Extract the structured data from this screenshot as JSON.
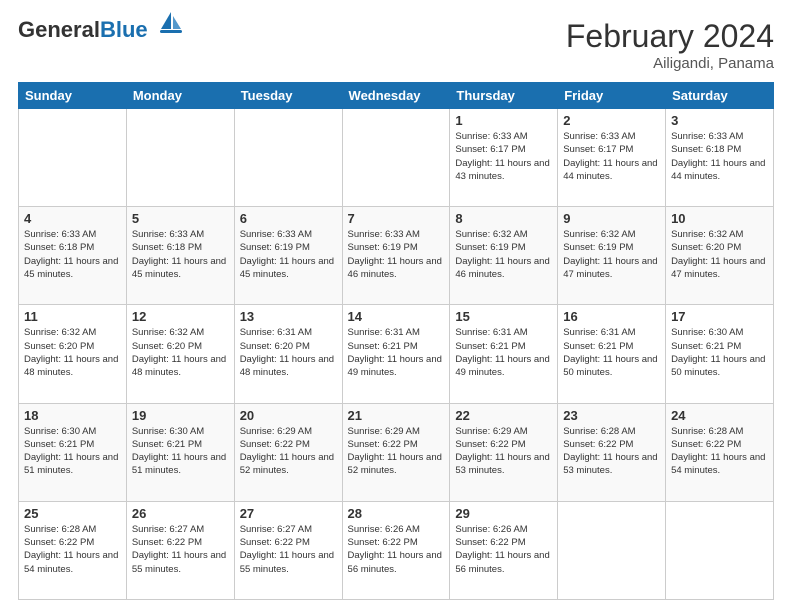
{
  "header": {
    "logo_general": "General",
    "logo_blue": "Blue",
    "month_title": "February 2024",
    "location": "Ailigandi, Panama"
  },
  "days_of_week": [
    "Sunday",
    "Monday",
    "Tuesday",
    "Wednesday",
    "Thursday",
    "Friday",
    "Saturday"
  ],
  "weeks": [
    [
      {
        "day": "",
        "info": ""
      },
      {
        "day": "",
        "info": ""
      },
      {
        "day": "",
        "info": ""
      },
      {
        "day": "",
        "info": ""
      },
      {
        "day": "1",
        "info": "Sunrise: 6:33 AM\nSunset: 6:17 PM\nDaylight: 11 hours\nand 43 minutes."
      },
      {
        "day": "2",
        "info": "Sunrise: 6:33 AM\nSunset: 6:17 PM\nDaylight: 11 hours\nand 44 minutes."
      },
      {
        "day": "3",
        "info": "Sunrise: 6:33 AM\nSunset: 6:18 PM\nDaylight: 11 hours\nand 44 minutes."
      }
    ],
    [
      {
        "day": "4",
        "info": "Sunrise: 6:33 AM\nSunset: 6:18 PM\nDaylight: 11 hours\nand 45 minutes."
      },
      {
        "day": "5",
        "info": "Sunrise: 6:33 AM\nSunset: 6:18 PM\nDaylight: 11 hours\nand 45 minutes."
      },
      {
        "day": "6",
        "info": "Sunrise: 6:33 AM\nSunset: 6:19 PM\nDaylight: 11 hours\nand 45 minutes."
      },
      {
        "day": "7",
        "info": "Sunrise: 6:33 AM\nSunset: 6:19 PM\nDaylight: 11 hours\nand 46 minutes."
      },
      {
        "day": "8",
        "info": "Sunrise: 6:32 AM\nSunset: 6:19 PM\nDaylight: 11 hours\nand 46 minutes."
      },
      {
        "day": "9",
        "info": "Sunrise: 6:32 AM\nSunset: 6:19 PM\nDaylight: 11 hours\nand 47 minutes."
      },
      {
        "day": "10",
        "info": "Sunrise: 6:32 AM\nSunset: 6:20 PM\nDaylight: 11 hours\nand 47 minutes."
      }
    ],
    [
      {
        "day": "11",
        "info": "Sunrise: 6:32 AM\nSunset: 6:20 PM\nDaylight: 11 hours\nand 48 minutes."
      },
      {
        "day": "12",
        "info": "Sunrise: 6:32 AM\nSunset: 6:20 PM\nDaylight: 11 hours\nand 48 minutes."
      },
      {
        "day": "13",
        "info": "Sunrise: 6:31 AM\nSunset: 6:20 PM\nDaylight: 11 hours\nand 48 minutes."
      },
      {
        "day": "14",
        "info": "Sunrise: 6:31 AM\nSunset: 6:21 PM\nDaylight: 11 hours\nand 49 minutes."
      },
      {
        "day": "15",
        "info": "Sunrise: 6:31 AM\nSunset: 6:21 PM\nDaylight: 11 hours\nand 49 minutes."
      },
      {
        "day": "16",
        "info": "Sunrise: 6:31 AM\nSunset: 6:21 PM\nDaylight: 11 hours\nand 50 minutes."
      },
      {
        "day": "17",
        "info": "Sunrise: 6:30 AM\nSunset: 6:21 PM\nDaylight: 11 hours\nand 50 minutes."
      }
    ],
    [
      {
        "day": "18",
        "info": "Sunrise: 6:30 AM\nSunset: 6:21 PM\nDaylight: 11 hours\nand 51 minutes."
      },
      {
        "day": "19",
        "info": "Sunrise: 6:30 AM\nSunset: 6:21 PM\nDaylight: 11 hours\nand 51 minutes."
      },
      {
        "day": "20",
        "info": "Sunrise: 6:29 AM\nSunset: 6:22 PM\nDaylight: 11 hours\nand 52 minutes."
      },
      {
        "day": "21",
        "info": "Sunrise: 6:29 AM\nSunset: 6:22 PM\nDaylight: 11 hours\nand 52 minutes."
      },
      {
        "day": "22",
        "info": "Sunrise: 6:29 AM\nSunset: 6:22 PM\nDaylight: 11 hours\nand 53 minutes."
      },
      {
        "day": "23",
        "info": "Sunrise: 6:28 AM\nSunset: 6:22 PM\nDaylight: 11 hours\nand 53 minutes."
      },
      {
        "day": "24",
        "info": "Sunrise: 6:28 AM\nSunset: 6:22 PM\nDaylight: 11 hours\nand 54 minutes."
      }
    ],
    [
      {
        "day": "25",
        "info": "Sunrise: 6:28 AM\nSunset: 6:22 PM\nDaylight: 11 hours\nand 54 minutes."
      },
      {
        "day": "26",
        "info": "Sunrise: 6:27 AM\nSunset: 6:22 PM\nDaylight: 11 hours\nand 55 minutes."
      },
      {
        "day": "27",
        "info": "Sunrise: 6:27 AM\nSunset: 6:22 PM\nDaylight: 11 hours\nand 55 minutes."
      },
      {
        "day": "28",
        "info": "Sunrise: 6:26 AM\nSunset: 6:22 PM\nDaylight: 11 hours\nand 56 minutes."
      },
      {
        "day": "29",
        "info": "Sunrise: 6:26 AM\nSunset: 6:22 PM\nDaylight: 11 hours\nand 56 minutes."
      },
      {
        "day": "",
        "info": ""
      },
      {
        "day": "",
        "info": ""
      }
    ]
  ]
}
